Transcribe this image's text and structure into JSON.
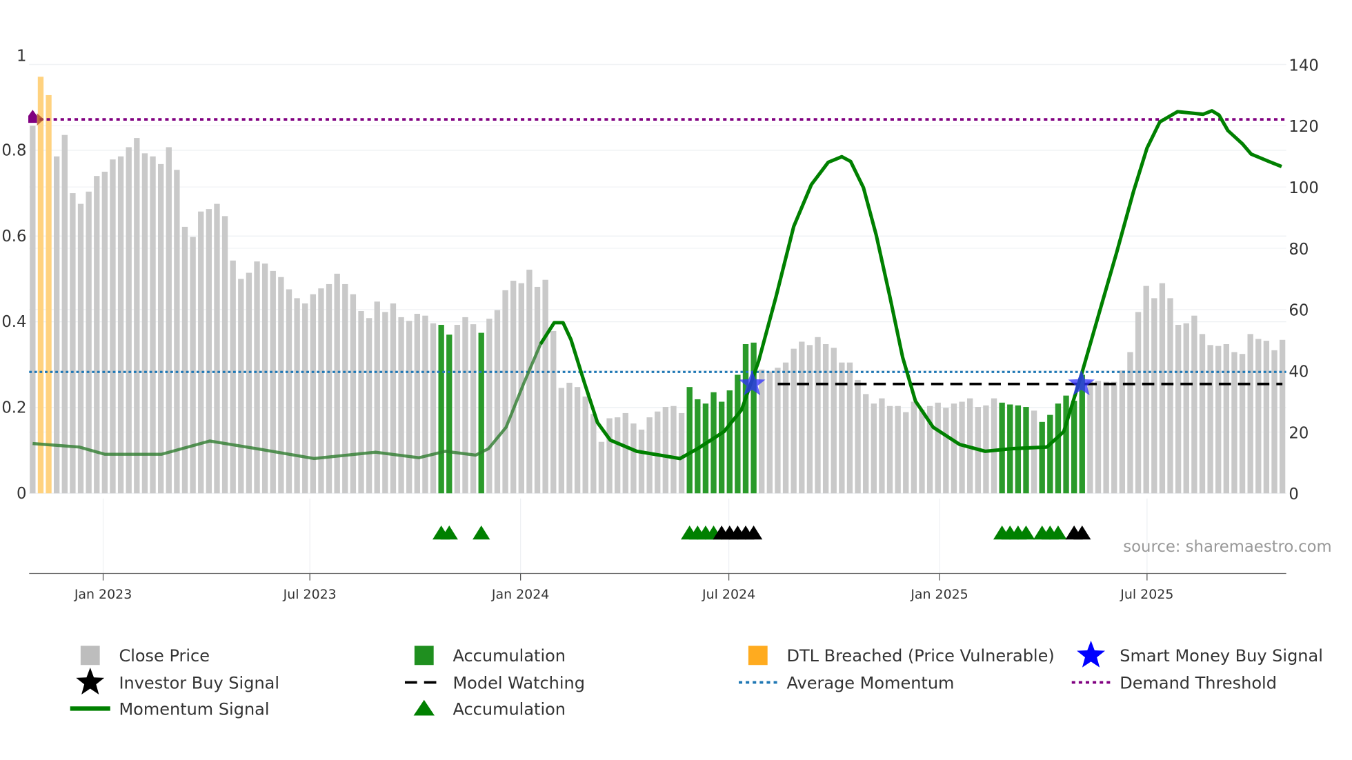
{
  "chart_data": {
    "type": "bar",
    "title": "",
    "source": "source: sharemaestro.com",
    "left_axis": {
      "ylim": [
        0,
        1
      ],
      "ticks": [
        0,
        0.2,
        0.4,
        0.6,
        0.8,
        1
      ],
      "tick_labels": [
        "0",
        "0.2",
        "0.4",
        "0.6",
        "0.8",
        "1"
      ]
    },
    "right_axis": {
      "ylim": [
        0,
        140
      ],
      "ticks": [
        0,
        20,
        40,
        60,
        80,
        100,
        120,
        140
      ],
      "tick_labels": [
        "0",
        "20",
        "40",
        "60",
        "80",
        "100",
        "120",
        "140"
      ]
    },
    "x_axis": {
      "unit": "week index",
      "xlim": [
        0,
        156
      ],
      "ticks": [
        8.8,
        34.6,
        60.9,
        86.9,
        113.2,
        139.1
      ],
      "tick_labels": [
        "Jan 2023",
        "Jul 2023",
        "Jan 2024",
        "Jul 2024",
        "Jan 2025",
        "Jul 2025"
      ]
    },
    "grid": true,
    "close_price": [
      120,
      136,
      130,
      110,
      117,
      98,
      94.5,
      98.5,
      103.6,
      105,
      109,
      110,
      113,
      116,
      111,
      110,
      107.5,
      113,
      105.6,
      87,
      83.7,
      92,
      92.8,
      94.5,
      90.5,
      76,
      70,
      72,
      75.7,
      75,
      72.6,
      70.6,
      66.6,
      63.7,
      62,
      65,
      66.9,
      68.3,
      71.7,
      68.3,
      65,
      59.5,
      57.2,
      62.6,
      59.2,
      62,
      57.5,
      56.3,
      58.6,
      58,
      55.5,
      55,
      51.8,
      55,
      57.5,
      55.2,
      52.4,
      57,
      59.8,
      66.3,
      69.4,
      68.6,
      73,
      67.4,
      69.7,
      53,
      34.4,
      36.1,
      34.7,
      31.6,
      25.9,
      16.8,
      24.5,
      24.8,
      26.2,
      22.8,
      20.8,
      24.8,
      26.7,
      28.2,
      28.5,
      26.2,
      34.7,
      30.7,
      29.3,
      33,
      29.9,
      33.6,
      38.7,
      48.7,
      49.2,
      40.4,
      39.8,
      41,
      42.7,
      47.2,
      49.5,
      48.4,
      51,
      48.7,
      47.5,
      42.7,
      42.7,
      37,
      32.4,
      29.3,
      31,
      28.5,
      28.5,
      26.5,
      29.9,
      27.3,
      28.5,
      29.6,
      27.9,
      29.3,
      29.9,
      31,
      28.2,
      28.7,
      31,
      29.6,
      29,
      28.7,
      28.2,
      27,
      23.3,
      25.6,
      29.3,
      31.9,
      30.2,
      38.7,
      36.7,
      36.7,
      36.4,
      36.4,
      40.1,
      46.1,
      59.2,
      67.7,
      63.7,
      68.6,
      63.7,
      55,
      55.5,
      58,
      52,
      48.4,
      48.1,
      48.7,
      46.1,
      45.5,
      52,
      50.4,
      49.8,
      46.7,
      50.1
    ],
    "accumulation_bars": [
      51,
      52,
      56,
      82,
      83,
      84,
      85,
      86,
      87,
      88,
      89,
      90,
      121,
      122,
      123,
      124,
      126,
      127,
      128,
      129,
      130,
      131
    ],
    "dtl_breached_bars": [
      1,
      2
    ],
    "momentum_signal": [
      [
        0,
        0.116
      ],
      [
        5.8,
        0.108
      ],
      [
        9,
        0.091
      ],
      [
        16.1,
        0.091
      ],
      [
        22.1,
        0.122
      ],
      [
        28.6,
        0.102
      ],
      [
        35.1,
        0.081
      ],
      [
        42.8,
        0.096
      ],
      [
        48.2,
        0.083
      ],
      [
        51.5,
        0.098
      ],
      [
        55.3,
        0.089
      ],
      [
        56.9,
        0.104
      ],
      [
        59.1,
        0.154
      ],
      [
        61.3,
        0.256
      ],
      [
        63.4,
        0.348
      ],
      [
        65.1,
        0.398
      ],
      [
        66.2,
        0.398
      ],
      [
        67.2,
        0.358
      ],
      [
        68.9,
        0.256
      ],
      [
        70.5,
        0.165
      ],
      [
        72.1,
        0.124
      ],
      [
        75.4,
        0.098
      ],
      [
        80.8,
        0.081
      ],
      [
        83,
        0.104
      ],
      [
        86.3,
        0.144
      ],
      [
        88.5,
        0.195
      ],
      [
        90.6,
        0.307
      ],
      [
        92.8,
        0.459
      ],
      [
        95,
        0.622
      ],
      [
        97.2,
        0.72
      ],
      [
        99.3,
        0.772
      ],
      [
        101,
        0.785
      ],
      [
        102.1,
        0.774
      ],
      [
        103.7,
        0.713
      ],
      [
        105.3,
        0.602
      ],
      [
        107,
        0.459
      ],
      [
        108.6,
        0.317
      ],
      [
        110.2,
        0.215
      ],
      [
        112.4,
        0.154
      ],
      [
        115.7,
        0.114
      ],
      [
        118.9,
        0.098
      ],
      [
        122.2,
        0.104
      ],
      [
        126.6,
        0.108
      ],
      [
        128.7,
        0.144
      ],
      [
        130.9,
        0.276
      ],
      [
        133.1,
        0.419
      ],
      [
        135.3,
        0.561
      ],
      [
        137.4,
        0.703
      ],
      [
        139.1,
        0.805
      ],
      [
        140.7,
        0.866
      ],
      [
        142.9,
        0.89
      ],
      [
        146.1,
        0.884
      ],
      [
        147.2,
        0.892
      ],
      [
        148.1,
        0.882
      ],
      [
        149.2,
        0.846
      ],
      [
        151,
        0.815
      ],
      [
        152.1,
        0.791
      ],
      [
        154.3,
        0.774
      ],
      [
        155.9,
        0.762
      ]
    ],
    "average_momentum": 0.283,
    "demand_threshold": 0.872,
    "model_watching": {
      "value": 0.255,
      "x_range": [
        93,
        156
      ]
    },
    "smart_money_buy_signals": [
      [
        89.8,
        0.255
      ],
      [
        130.9,
        0.255
      ]
    ],
    "accumulation_markers": [
      51,
      52,
      56,
      82,
      83,
      84,
      85,
      121,
      122,
      123,
      124,
      126,
      127,
      128
    ],
    "investor_buy_signals": [
      86,
      87,
      88,
      89,
      90,
      130,
      131
    ],
    "legend": [
      {
        "label": "Close Price",
        "symbol": "square",
        "color": "#bdbdbd"
      },
      {
        "label": "Accumulation",
        "symbol": "square",
        "color": "#1f8f1f"
      },
      {
        "label": "DTL Breached (Price Vulnerable)",
        "symbol": "square",
        "color": "#ffab1f"
      },
      {
        "label": "Smart Money Buy Signal",
        "symbol": "star",
        "color": "#0000ff"
      },
      {
        "label": "Investor Buy Signal",
        "symbol": "star",
        "color": "#000000"
      },
      {
        "label": "Model Watching",
        "symbol": "dash",
        "color": "#000000"
      },
      {
        "label": "Average Momentum",
        "symbol": "dot",
        "color": "#1f77b4"
      },
      {
        "label": "Demand Threshold",
        "symbol": "dot",
        "color": "#800080"
      },
      {
        "label": "Momentum Signal",
        "symbol": "line",
        "color": "#008000"
      },
      {
        "label": "Accumulation",
        "symbol": "triangle",
        "color": "#008000"
      }
    ],
    "legend_position": "bottom"
  }
}
